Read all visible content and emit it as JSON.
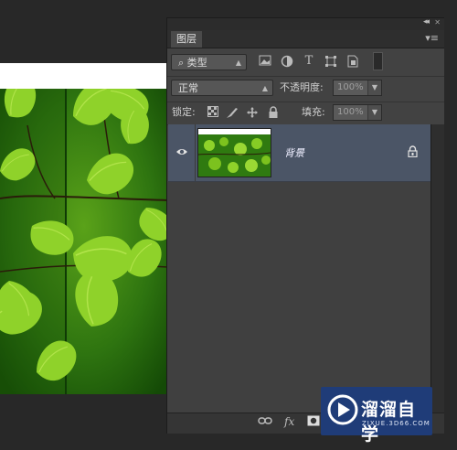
{
  "panel": {
    "tab_label": "图层",
    "collapse_glyph": "◂◂",
    "close_glyph": "✕",
    "menu_glyph": "▾≡"
  },
  "filter": {
    "kind_label": "类型",
    "search_glyph": "⌕",
    "icons": [
      "image-filter-icon",
      "adjustment-filter-icon",
      "type-filter-icon",
      "shape-filter-icon",
      "smart-object-filter-icon",
      "filter-toggle-icon"
    ],
    "type_glyph": "T"
  },
  "blend": {
    "mode": "正常",
    "opacity_label": "不透明度:",
    "opacity_value": "100%"
  },
  "lock": {
    "label": "锁定:",
    "icons": [
      "lock-transparent-icon",
      "lock-image-icon",
      "lock-position-icon",
      "lock-all-icon"
    ],
    "fill_label": "填充:",
    "fill_value": "100%"
  },
  "layers": [
    {
      "name": "背景",
      "visible": true,
      "locked": true,
      "selected": true
    }
  ],
  "footer": {
    "link_glyph": "⊖",
    "fx_label": "fx",
    "icons": [
      "link-layers-icon",
      "layer-style-icon",
      "add-mask-icon"
    ]
  },
  "watermark": {
    "title": "溜溜自学",
    "subtitle": "ZIXUE.3D66.COM"
  },
  "colors": {
    "panel_bg": "#424242",
    "selected_layer": "#4b5566",
    "watermark_bg": "#1f3c78"
  }
}
